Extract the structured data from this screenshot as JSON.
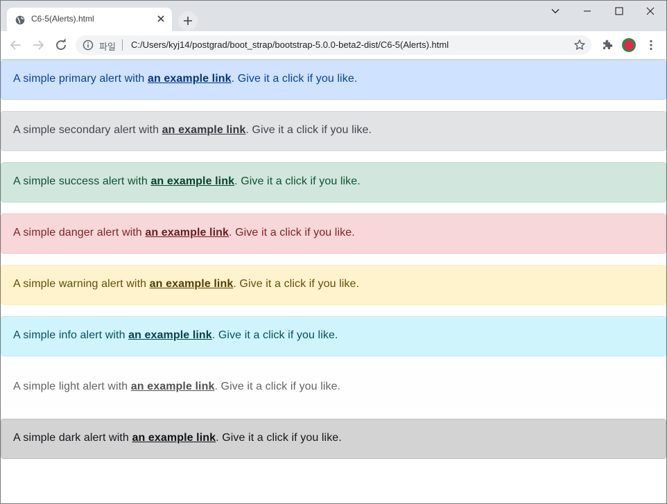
{
  "browser": {
    "tab_title": "C6-5(Alerts).html",
    "url_scheme": "파일",
    "url": "C:/Users/kyj14/postgrad/boot_strap/bootstrap-5.0.0-beta2-dist/C6-5(Alerts).html"
  },
  "alerts": [
    {
      "prefix": "A simple primary alert with ",
      "link": "an example link",
      "suffix": ". Give it a click if you like.",
      "bg": "#cfe2ff",
      "border": "#b6d4fe",
      "text": "#084298",
      "link_color": "#06357a"
    },
    {
      "prefix": "A simple secondary alert with ",
      "link": "an example link",
      "suffix": ". Give it a click if you like.",
      "bg": "#e2e3e5",
      "border": "#d3d6d8",
      "text": "#41464b",
      "link_color": "#34383c"
    },
    {
      "prefix": "A simple success alert with ",
      "link": "an example link",
      "suffix": ". Give it a click if you like.",
      "bg": "#d1e7dd",
      "border": "#badbcc",
      "text": "#0f5132",
      "link_color": "#0c4128"
    },
    {
      "prefix": "A simple danger alert with ",
      "link": "an example link",
      "suffix": ". Give it a click if you like.",
      "bg": "#f8d7da",
      "border": "#f5c2c7",
      "text": "#842029",
      "link_color": "#6a1a21"
    },
    {
      "prefix": "A simple warning alert with ",
      "link": "an example link",
      "suffix": ". Give it a click if you like.",
      "bg": "#fff3cd",
      "border": "#ffecb5",
      "text": "#664d03",
      "link_color": "#523e02"
    },
    {
      "prefix": "A simple info alert with ",
      "link": "an example link",
      "suffix": ". Give it a click if you like.",
      "bg": "#cff4fc",
      "border": "#b6effb",
      "text": "#055160",
      "link_color": "#04414d"
    },
    {
      "prefix": "A simple light alert with ",
      "link": "an example link",
      "suffix": ". Give it a click if you like.",
      "bg": "#fefefe",
      "border": "#fdfdfe",
      "text": "#636464",
      "link_color": "#4f5050"
    },
    {
      "prefix": "A simple dark alert with ",
      "link": "an example link",
      "suffix": ". Give it a click if you like.",
      "bg": "#d3d3d4",
      "border": "#bcbebf",
      "text": "#141619",
      "link_color": "#101214"
    }
  ]
}
